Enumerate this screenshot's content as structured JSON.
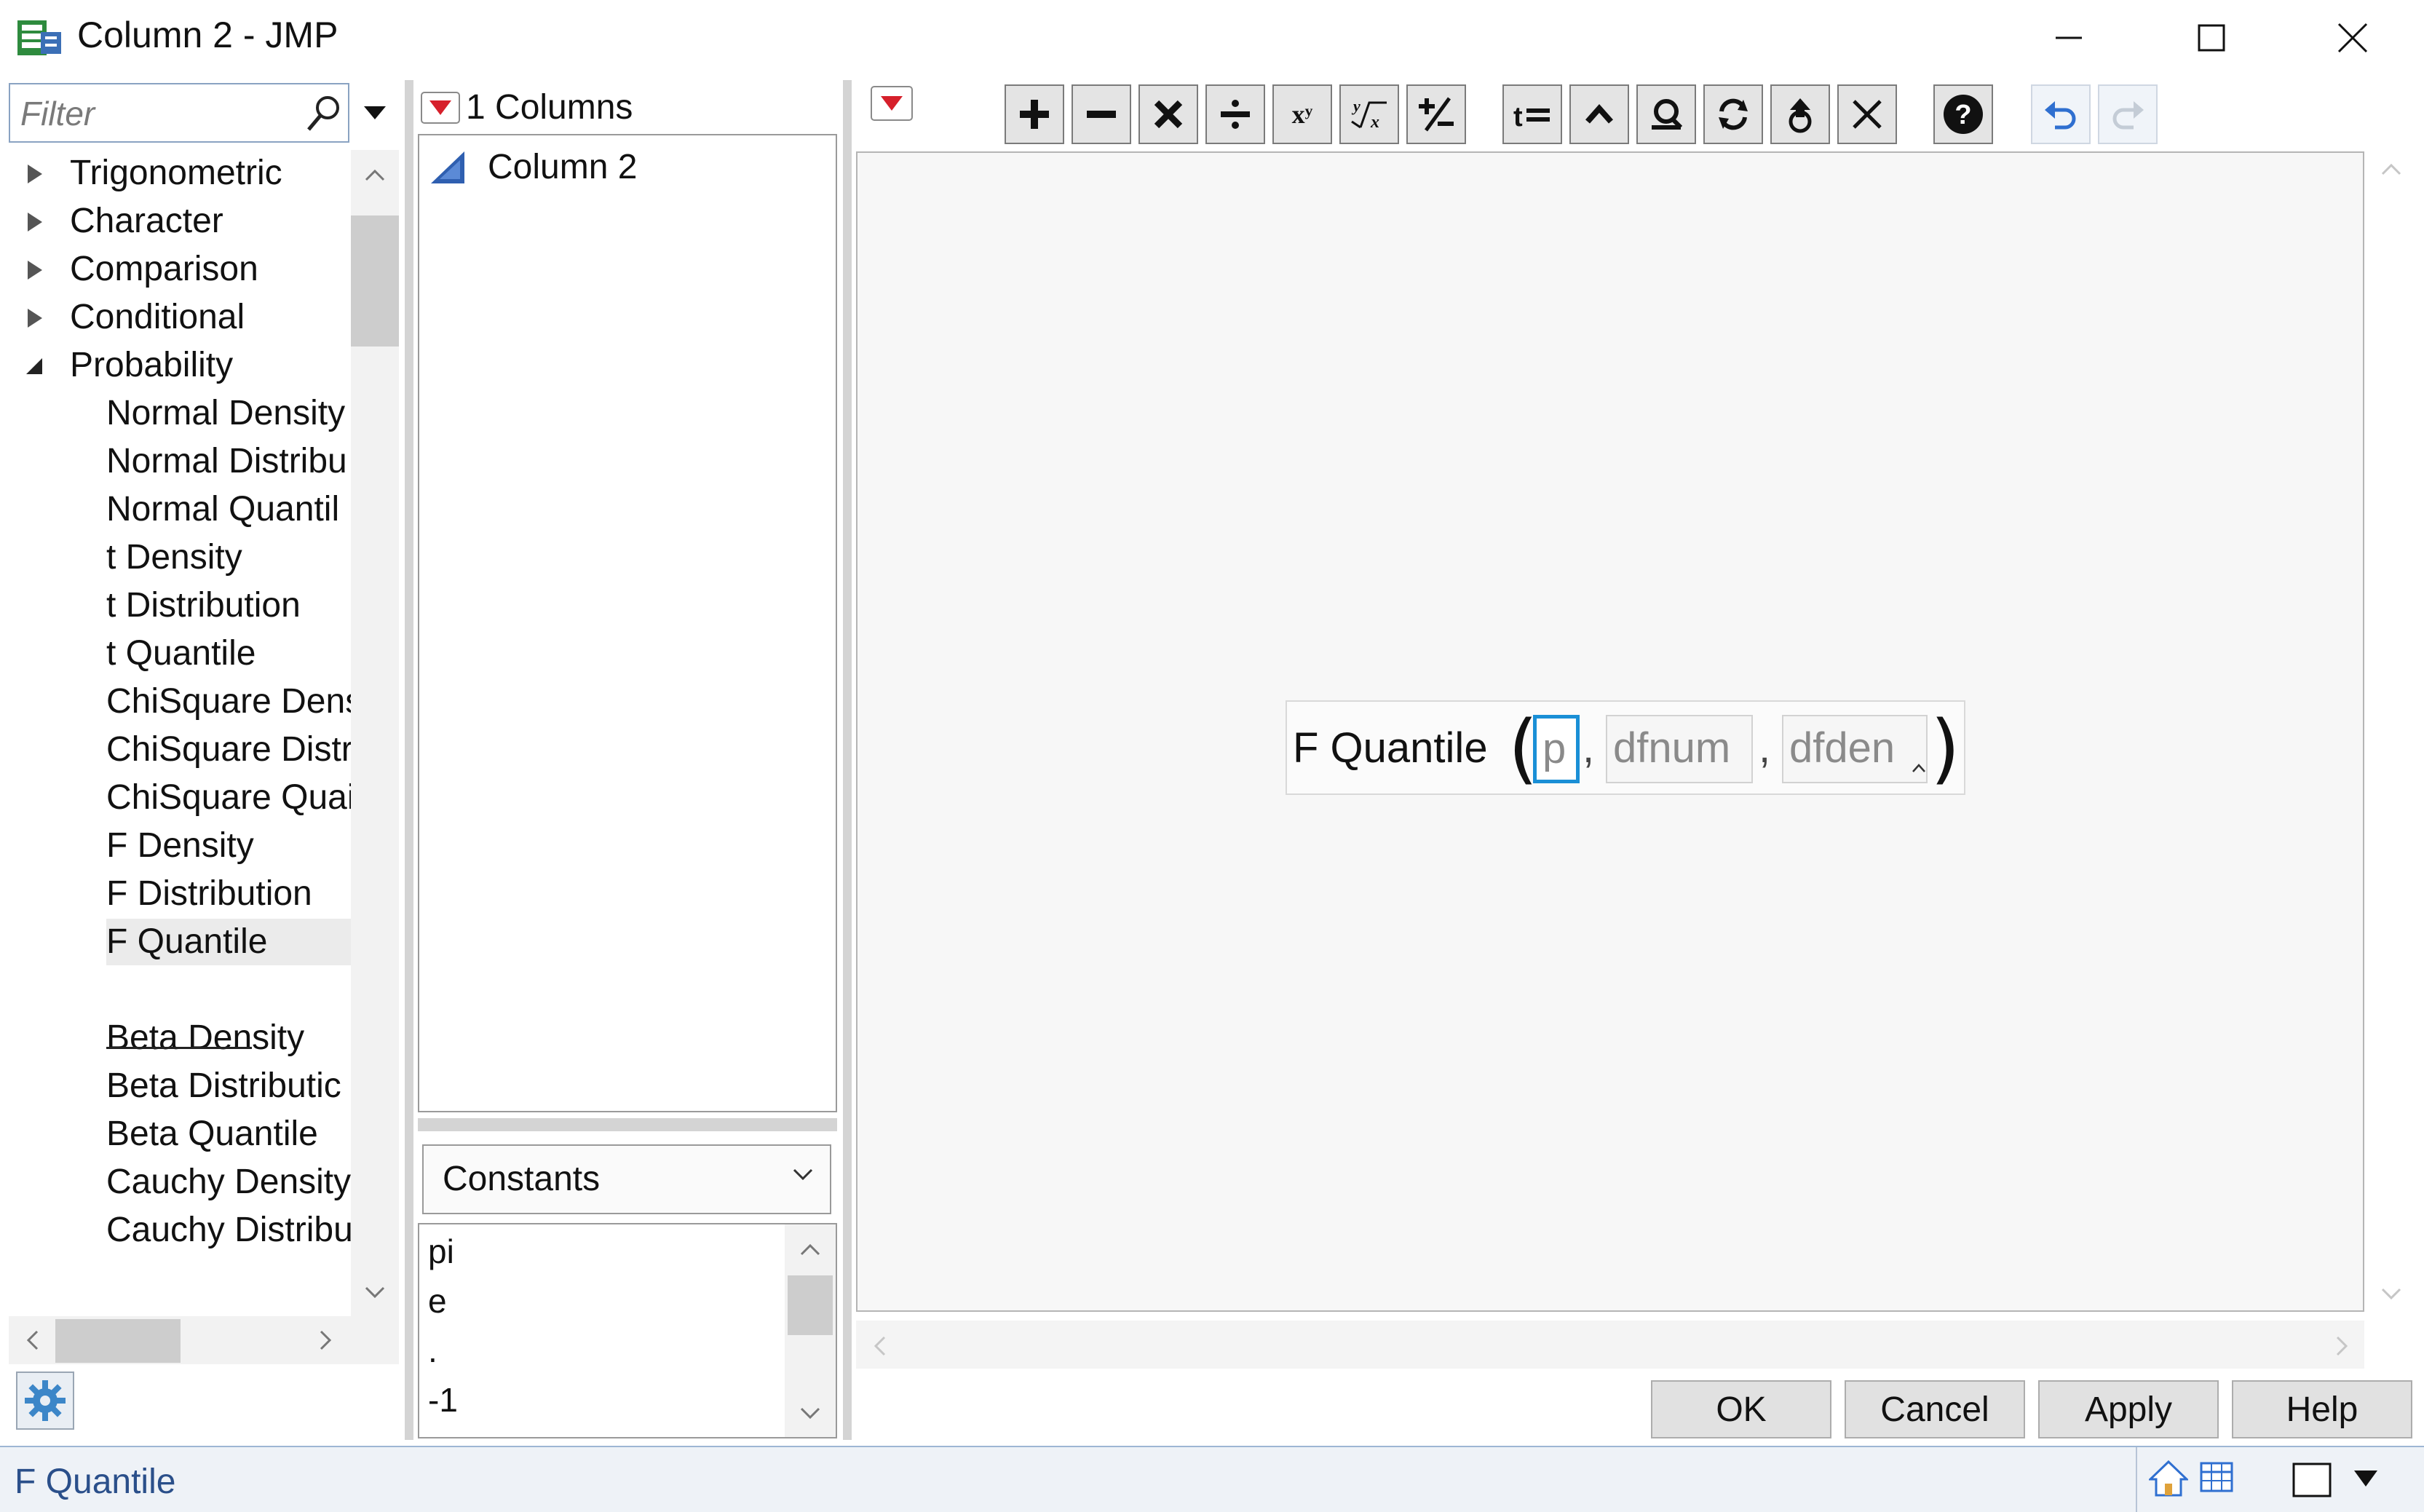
{
  "window": {
    "title": "Column 2 - JMP",
    "controls": [
      "minimize",
      "maximize",
      "close"
    ]
  },
  "function_panel": {
    "filter_placeholder": "Filter",
    "categories": [
      {
        "label": "Trigonometric",
        "state": "collapsed"
      },
      {
        "label": "Character",
        "state": "collapsed"
      },
      {
        "label": "Comparison",
        "state": "collapsed"
      },
      {
        "label": "Conditional",
        "state": "collapsed"
      },
      {
        "label": "Probability",
        "state": "expanded"
      }
    ],
    "functions": [
      "Normal Density",
      "Normal Distribu",
      "Normal Quantil",
      "t Density",
      "t Distribution",
      "t Quantile",
      "ChiSquare Dens",
      "ChiSquare Distr",
      "ChiSquare Quai",
      "F Density",
      "F Distribution",
      "F Quantile",
      "Beta Density",
      "Beta Distributic",
      "Beta Quantile",
      "Cauchy Density",
      "Cauchy Distribu"
    ],
    "selected_function": "F Quantile"
  },
  "columns_panel": {
    "header": "1 Columns",
    "items": [
      {
        "label": "Column 2",
        "icon": "continuous-column-icon"
      }
    ],
    "constants_select": "Constants",
    "constants": [
      "pi",
      "e",
      ".",
      "-1"
    ]
  },
  "toolbar": {
    "buttons": [
      "add-icon",
      "subtract-icon",
      "multiply-icon",
      "divide-icon",
      "power-icon",
      "root-icon",
      "negate-icon",
      "assign-icon",
      "caret-up-icon",
      "peel-icon",
      "swap-icon",
      "unthread-icon",
      "delete-icon",
      "help-icon",
      "undo-icon",
      "redo-icon"
    ],
    "power_label": "xʸ"
  },
  "formula": {
    "function_name": "F Quantile",
    "open_paren": "(",
    "close_paren": ")",
    "args": [
      "p",
      "dfnum",
      "dfden"
    ],
    "separator": ",",
    "active_arg": "p"
  },
  "dialog_buttons": {
    "ok": "OK",
    "cancel": "Cancel",
    "apply": "Apply",
    "help": "Help"
  },
  "status": {
    "text": "F Quantile"
  },
  "colors": {
    "active_border": "#1a8fd6",
    "dropdown_red": "#d6202b",
    "status_text": "#2a4f8a",
    "undo_blue": "#2f6fd0"
  }
}
